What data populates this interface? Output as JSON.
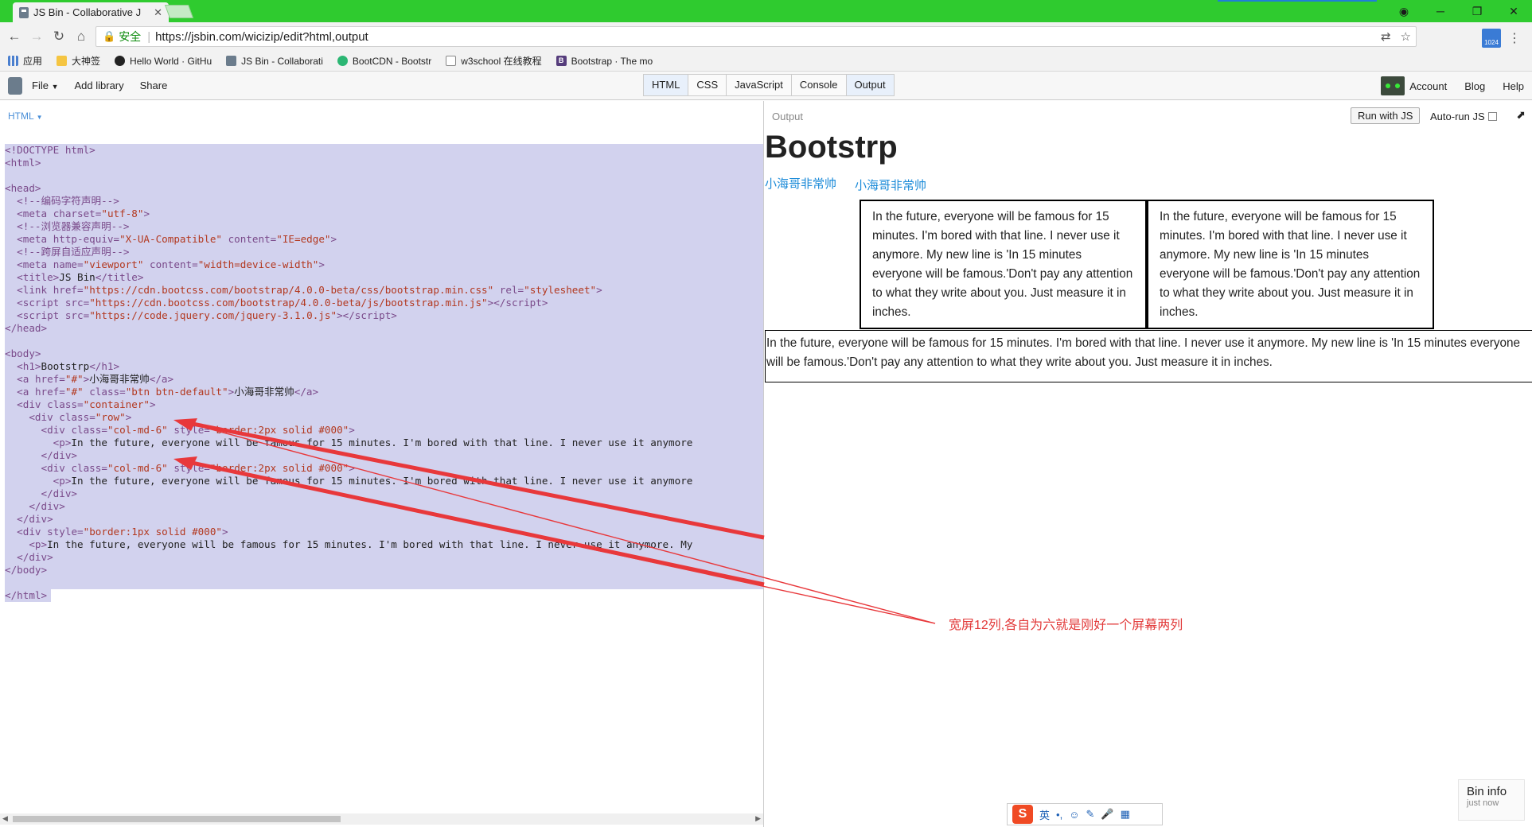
{
  "browser": {
    "tab_title": "JS Bin - Collaborative J",
    "tab_close": "✕",
    "secure_label": "安全",
    "url": "https://jsbin.com/wicizip/edit?html,output",
    "ext_badge": "1024",
    "bookmarks": [
      "应用",
      "大神签",
      "Hello World · GitHu",
      "JS Bin - Collaborati",
      "BootCDN - Bootstr",
      "w3school 在线教程",
      "Bootstrap · The mo"
    ]
  },
  "jsbin": {
    "menu": [
      "File",
      "Add library",
      "Share"
    ],
    "panels": [
      "HTML",
      "CSS",
      "JavaScript",
      "Console",
      "Output"
    ],
    "right": [
      "Account",
      "Blog",
      "Help"
    ],
    "editor_label": "HTML",
    "output_label": "Output",
    "run_button": "Run with JS",
    "autorun_label": "Auto-run JS"
  },
  "output": {
    "h1": "Bootstrp",
    "link1": "小海哥非常帅",
    "link2": "小海哥非常帅",
    "paragraph": "In the future, everyone will be famous for 15 minutes. I'm bored with that line. I never use it anymore. My new line is 'In 15 minutes everyone will be famous.'Don't pay any attention to what they write about you. Just measure it in inches."
  },
  "annotation": {
    "text": "宽屏12列,各自为六就是刚好一个屏幕两列",
    "color": "#e23a3a"
  },
  "ime": {
    "lang": "英"
  },
  "bininfo": {
    "title": "Bin info",
    "sub": "just now"
  }
}
